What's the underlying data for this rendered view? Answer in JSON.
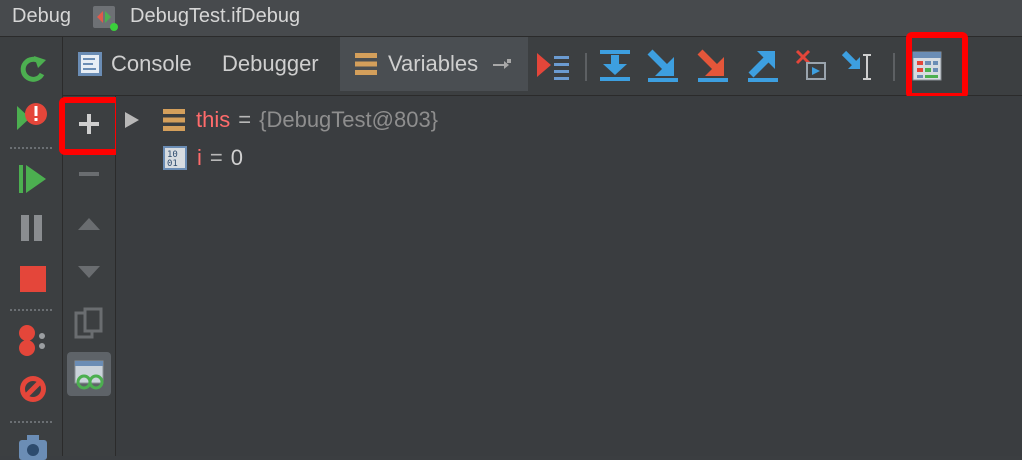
{
  "window": {
    "title_left": "Debug",
    "title_file": "DebugTest.ifDebug"
  },
  "tabs": [
    {
      "label": "Console",
      "icon": "console-icon"
    },
    {
      "label": "Debugger"
    },
    {
      "label": "Variables",
      "icon": "variables-icon",
      "selected": true
    }
  ],
  "toolbar_icons": [
    "show-execution-point-icon",
    "step-over-icon",
    "step-into-icon",
    "force-step-into-icon",
    "step-out-icon",
    "drop-frame-icon",
    "run-to-cursor-icon",
    "evaluate-expression-icon"
  ],
  "side_tools": [
    "rerun-icon",
    "stop-icon",
    "resume-icon",
    "pause-icon",
    "stop-program-icon",
    "view-breakpoints-icon",
    "mute-breakpoints-icon",
    "camera-icon"
  ],
  "var_tools": [
    "add-watch-icon",
    "remove-watch-icon",
    "move-up-icon",
    "move-down-icon",
    "duplicate-watch-icon",
    "watches-icon"
  ],
  "variables": [
    {
      "name": "this",
      "value": "{DebugTest@803}",
      "icon": "object-icon",
      "expandable": true
    },
    {
      "name": "i",
      "value": "0",
      "icon": "primitive-icon",
      "expandable": false
    }
  ],
  "colors": {
    "highlight": "#ff0000",
    "var_name": "#ff6b6b"
  }
}
